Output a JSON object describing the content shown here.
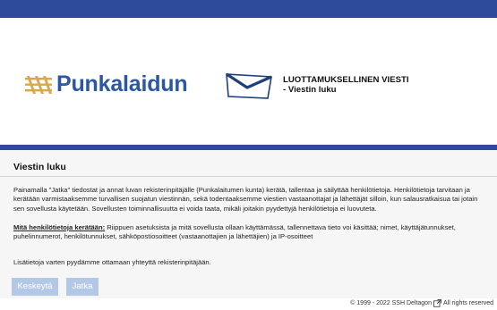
{
  "header": {
    "logo_text": "Punkalaidun",
    "title_line1": "LUOTTAMUKSELLINEN VIESTI",
    "title_line2": "- Viestin luku"
  },
  "main": {
    "title": "Viestin luku",
    "paragraph1": "Painamalla \"Jatka\" tiedostat ja annat luvan rekisterinpitäjälle (Punkalaitumen kunta) kerätä, tallentaa ja säilyttää henkilötietoja. Henkilötietoja tarvitaan ja kerätään varmistaaksemme turvallisen suojatun viestinnän, sekä todentaaksemme viestien vastaanottajat ja lähettäjät silloin, kun salausratkaisua tai jotain sen sovellusta käytetään. Sovellusten toiminnallisuutta ei voida taata, mikäli joitakin pyydettyjä henkilötietoja ei luovuteta.",
    "paragraph2_label": "Mitä henkilötietoja kerätään:",
    "paragraph2": " Riippuen asetuksista ja mitä sovellusta ollaan käyttämässä, tallennettava tieto voi käsittää; nimet, käyttäjätunnukset, puhelinnumerot, henkilötunnukset, sähköpostiosoitteet (vastaanottajien ja lähettäjien) ja IP-osoitteet",
    "paragraph3": "Lisätietoja varten pyydämme ottamaan yhteyttä rekisterinpitäjään.",
    "cancel_label": "Keskeytä",
    "continue_label": "Jatka"
  },
  "footer": {
    "copyright": "© 1999 - 2022 SSH Deltagon",
    "icon": "external-link-icon",
    "rights": "All rights reserved"
  },
  "colors": {
    "bar": "#2e4a9b",
    "logo": "#2b57a3",
    "logo_mark": "#d9a84a",
    "button": "#b3c8e7",
    "content_bg": "#f6f6f6"
  }
}
